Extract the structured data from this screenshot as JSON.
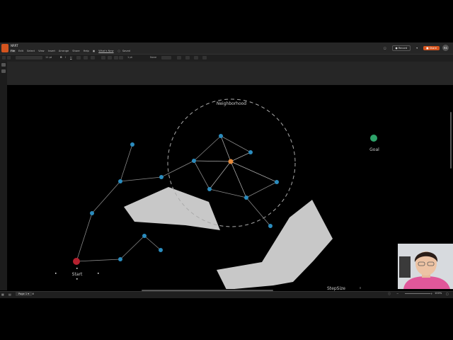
{
  "app": {
    "doc_title": "NRRT",
    "menu": [
      "File",
      "Edit",
      "Select",
      "View",
      "Insert",
      "Arrange",
      "Share",
      "Help"
    ],
    "whats_new": "What's New",
    "saved_status": "Saved",
    "record_label": "Record",
    "share_label": "Share",
    "avatar_initials": "RS",
    "brand_color": "#d4541e"
  },
  "toolbar": {
    "font_size": "11 pt",
    "line_style": "1 pt",
    "stroke_label": "None"
  },
  "diagram": {
    "neighborhood_label": "Neighborhood",
    "start_label": "Start",
    "goal_label": "Goal",
    "step_size_label": "StepSize",
    "node_color": "#2b8cbe",
    "start_color": "#b5202e",
    "goal_color": "#2ea36a",
    "new_node_color": "#e48a3c",
    "obstacle_color": "#c8c8c8"
  },
  "status": {
    "page_tab": "Page 1",
    "zoom": "100%"
  }
}
